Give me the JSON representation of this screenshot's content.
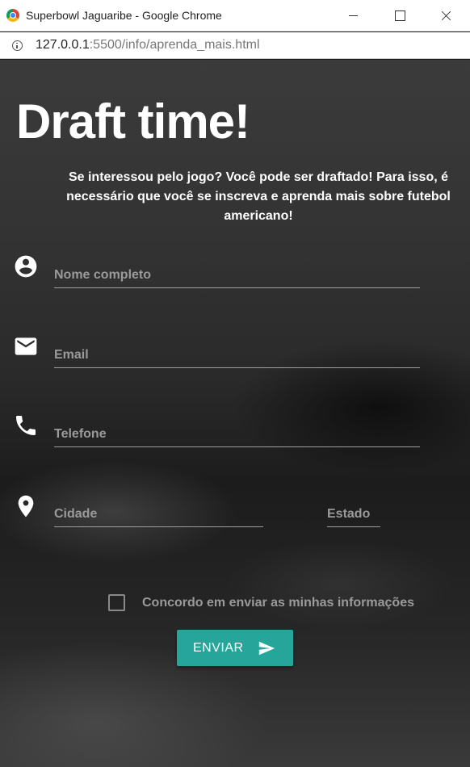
{
  "window": {
    "title": "Superbowl Jaguaribe - Google Chrome",
    "controls": [
      "minimize-icon",
      "maximize-icon",
      "close-icon"
    ]
  },
  "addressbar": {
    "icon": "info-icon",
    "url_host": "127.0.0.1",
    "url_rest": ":5500/info/aprenda_mais.html"
  },
  "page": {
    "headline": "Draft time!",
    "intro": "Se interessou pelo jogo? Você pode ser draftado! Para isso, é necessário que você se inscreva e aprenda mais sobre futebol americano!"
  },
  "form": {
    "name": {
      "icon": "account-circle-icon",
      "placeholder": "Nome completo",
      "value": ""
    },
    "email": {
      "icon": "email-icon",
      "placeholder": "Email",
      "value": ""
    },
    "phone": {
      "icon": "phone-icon",
      "placeholder": "Telefone",
      "value": ""
    },
    "city": {
      "icon": "location-pin-icon",
      "placeholder": "Cidade",
      "value": ""
    },
    "state": {
      "placeholder": "Estado",
      "value": ""
    },
    "consent": {
      "label": "Concordo em enviar as minhas informações",
      "checked": false
    },
    "submit": {
      "label": "ENVIAR",
      "icon": "send-icon"
    }
  },
  "colors": {
    "accent": "#26a69a",
    "text": "#ffffff",
    "placeholder": "#9a9a9a"
  }
}
